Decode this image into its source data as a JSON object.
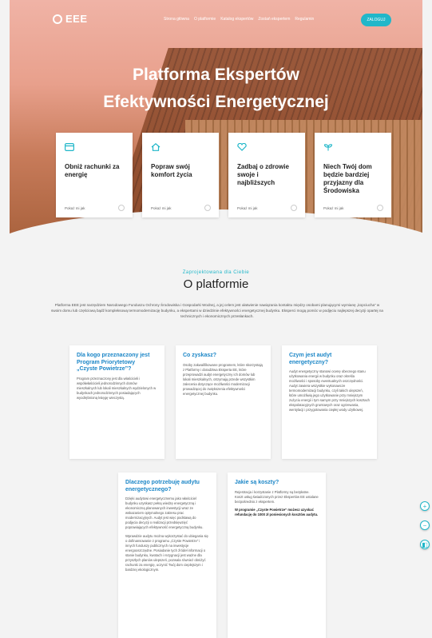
{
  "brand": {
    "logo_text": "EEE"
  },
  "nav": {
    "links": [
      "Strona główna",
      "O platformie",
      "Katalog ekspertów",
      "Zostań ekspertem",
      "Regulamin"
    ],
    "cta_label": "ZALOGUJ"
  },
  "hero": {
    "title_line1": "Platforma Ekspertów",
    "title_line2": "Efektywności Energetycznej"
  },
  "features": [
    {
      "icon": "wallet-icon",
      "title": "Obniż rachunki za energię",
      "more": "Pokaż mi jak"
    },
    {
      "icon": "home-icon",
      "title": "Popraw swój komfort życia",
      "more": "Pokaż mi jak"
    },
    {
      "icon": "heart-icon",
      "title": "Zadbaj o zdrowie swoje i najbliższych",
      "more": "Pokaż mi jak"
    },
    {
      "icon": "plant-icon",
      "title": "Niech Twój dom będzie bardziej przyjazny dla Środowiska",
      "more": "Pokaż mi jak"
    }
  ],
  "about": {
    "kicker": "Zaprojektowana dla Ciebie",
    "title": "O platformie",
    "description": "Platforma EEE jest narzędziem Narodowego Funduszu Ochrony Środowiska i Gospodarki Wodnej, a jej celem jest ułatwienie nawiązania kontaktu między osobami planującymi wymianę „kopciucha” w swoim domu lub częściową bądź kompleksową termomodernizację budynku, a ekspertami w dziedzinie efektywności energetycznej budynku. Eksperci mogą pomóc w podjęciu najlepszej decyzji opartej na technicznych i ekonomicznych przesłankach."
  },
  "cards": [
    {
      "title": "Dla kogo przeznaczony jest Program Priorytetowy „Czyste Powietrze”?",
      "text": "Program przeznaczony jest dla właścicieli i współwłaścicieli jednorodzinnych domów mieszkalnych lub lokali mieszkalnych wydzielonych w budynkach jednorodzinnych posiadających wyodrębnioną księgę wieczystą."
    },
    {
      "title": "Co zyskasz?",
      "text": "Osoby zakwalifikowane programem, które skorzystają z Platformy i doradztwa Eksperta EE, które przeprowadzi audyt energetyczny ich domów lub lokali mieszkalnych, otrzymają przede wszystkim zalecenia dotyczące możliwości modernizacji prowadzącej do zwiększenia efektywności energetycznej budynku."
    },
    {
      "title": "Czym jest audyt energetyczny?",
      "text": "Audyt energetyczny stanowi ocenę obecnego stanu użytkowania energii w budynku oraz określa możliwości i sposoby ewentualnych oszczędności. Audyt zawiera wszystkie wykonawcze termomodernizacji budynku, czyli takich ulepszeń, które umożliwią jego użytkowanie przy mniejszym zużyciu energii i tym samym przy mniejszych kosztach ekspolatacyjnych gruntowych oraz ogrzewania, wentylacji i przygotowania ciepłej wody użytkowej."
    },
    {
      "title": "Dlaczego potrzebuję audytu energetycznego?",
      "text": "Dzięki audytowi energetycznemu jako właściciel budynku uzyskasz pełną wiedzę energetyczną i ekonomiczną planowanych inwestycji wraz ze wskazaniem optymalnego zakresu prac modernizacyjnych. Audyt jest więc podstawą do podjęcia decyzji o realizacji przedsięwzięć poprawiających efektywność energetyczną budynku.",
      "text2": "Wprawdzie audytu można wykorzystać do ubiegania się o dofinansowanie z programu „Czyste Powietrze” i innych funduszy publicznych na inwestycje energooszczędne. Posiadanie tych źródeł informacji o stanie budynku, kwotach i rezygnacji jest ważne dla przyszłych planów ulepszeń, pozwala również obniżyć rachunki za energię, uczynić Twój dom cieplejszym i bardziej ekologicznym."
    },
    {
      "title": "Jakie są koszty?",
      "text": "Rejestracja i korzystanie z Platformy są bezpłatne. Koszt usług świadczonych przez Ekspertów EE ustalane bezpośrednio z ekspertem.",
      "text2": "W programie „Czyste Powietrze” możesz uzyskać refundację do 1000 zł poniesionych kosztów audytu."
    }
  ]
}
